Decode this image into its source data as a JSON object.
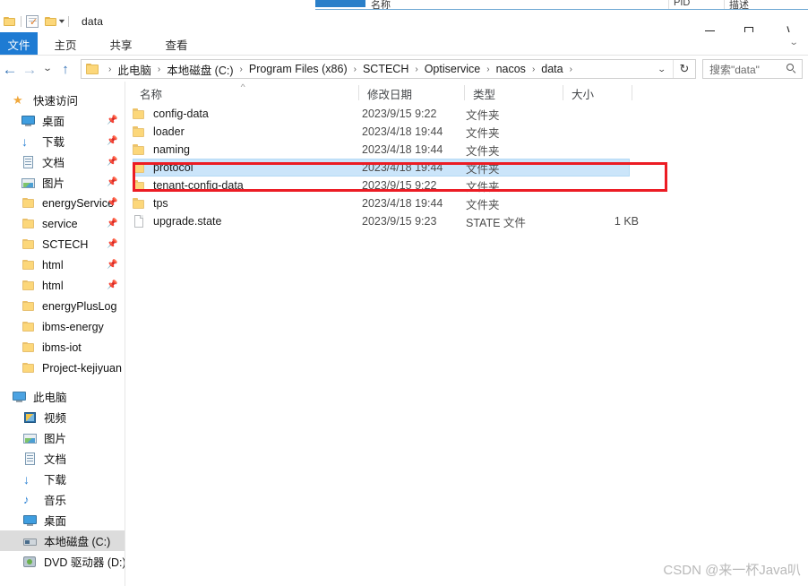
{
  "background_window": {
    "columns": [
      "名称",
      "PID",
      "描述"
    ]
  },
  "titlebar": {
    "title": "data",
    "quick_access": [
      {
        "name": "folder-icon",
        "label": "文件夹"
      },
      {
        "name": "properties-icon",
        "label": "属性"
      },
      {
        "name": "new-folder-icon",
        "label": "新建文件夹"
      }
    ],
    "customize_caret": "▾",
    "controls": {
      "minimize": "—",
      "maximize": "▢",
      "close": "✕"
    }
  },
  "ribbon": {
    "tabs": [
      {
        "label": "文件",
        "active": true
      },
      {
        "label": "主页",
        "active": false
      },
      {
        "label": "共享",
        "active": false
      },
      {
        "label": "查看",
        "active": false
      }
    ],
    "expand_caret": "⌄"
  },
  "addressbar": {
    "back": "←",
    "forward": "→",
    "recent": "⌄",
    "up": "↑",
    "breadcrumbs": [
      "此电脑",
      "本地磁盘 (C:)",
      "Program Files (x86)",
      "SCTECH",
      "Optiservice",
      "nacos",
      "data"
    ],
    "separator": "›",
    "dropdown_caret": "⌄",
    "refresh": "↻",
    "search_placeholder": "搜索\"data\"",
    "search_value": ""
  },
  "navpane": {
    "groups": [
      {
        "header": {
          "label": "快速访问",
          "icon": "star-icon"
        },
        "items": [
          {
            "label": "桌面",
            "icon": "desktop-icon",
            "pinned": true
          },
          {
            "label": "下载",
            "icon": "download-icon",
            "pinned": true
          },
          {
            "label": "文档",
            "icon": "document-icon",
            "pinned": true
          },
          {
            "label": "图片",
            "icon": "picture-icon",
            "pinned": true
          },
          {
            "label": "energyService",
            "icon": "folder-icon",
            "pinned": true
          },
          {
            "label": "service",
            "icon": "folder-icon",
            "pinned": true
          },
          {
            "label": "SCTECH",
            "icon": "folder-icon",
            "pinned": true
          },
          {
            "label": "html",
            "icon": "folder-icon",
            "pinned": true
          },
          {
            "label": "html",
            "icon": "folder-icon",
            "pinned": true
          },
          {
            "label": "energyPlusLog",
            "icon": "folder-icon",
            "pinned": false
          },
          {
            "label": "ibms-energy",
            "icon": "folder-icon",
            "pinned": false
          },
          {
            "label": "ibms-iot",
            "icon": "folder-icon",
            "pinned": false
          },
          {
            "label": "Project-kejiyuan",
            "icon": "folder-icon",
            "pinned": false
          }
        ]
      },
      {
        "header": {
          "label": "此电脑",
          "icon": "computer-icon"
        },
        "items": [
          {
            "label": "视频",
            "icon": "video-icon",
            "pinned": false
          },
          {
            "label": "图片",
            "icon": "picture-icon",
            "pinned": false
          },
          {
            "label": "文档",
            "icon": "document-icon",
            "pinned": false
          },
          {
            "label": "下载",
            "icon": "download-icon",
            "pinned": false
          },
          {
            "label": "音乐",
            "icon": "music-icon",
            "pinned": false
          },
          {
            "label": "桌面",
            "icon": "desktop-icon",
            "pinned": false
          },
          {
            "label": "本地磁盘 (C:)",
            "icon": "drive-icon",
            "pinned": false,
            "selected": true
          },
          {
            "label": "DVD 驱动器 (D:) S!",
            "icon": "dvd-icon",
            "pinned": false
          }
        ]
      }
    ]
  },
  "filelist": {
    "columns": [
      {
        "label": "名称",
        "sorted": true,
        "sort_dir": "asc"
      },
      {
        "label": "修改日期"
      },
      {
        "label": "类型"
      },
      {
        "label": "大小"
      }
    ],
    "rows": [
      {
        "name": "config-data",
        "date": "2023/9/15 9:22",
        "type": "文件夹",
        "size": "",
        "icon": "folder-icon",
        "selected": false
      },
      {
        "name": "loader",
        "date": "2023/4/18 19:44",
        "type": "文件夹",
        "size": "",
        "icon": "folder-icon",
        "selected": false
      },
      {
        "name": "naming",
        "date": "2023/4/18 19:44",
        "type": "文件夹",
        "size": "",
        "icon": "folder-icon",
        "selected": false
      },
      {
        "name": "protocol",
        "date": "2023/4/18 19:44",
        "type": "文件夹",
        "size": "",
        "icon": "folder-icon",
        "selected": true
      },
      {
        "name": "tenant-config-data",
        "date": "2023/9/15 9:22",
        "type": "文件夹",
        "size": "",
        "icon": "folder-icon",
        "selected": false
      },
      {
        "name": "tps",
        "date": "2023/4/18 19:44",
        "type": "文件夹",
        "size": "",
        "icon": "folder-icon",
        "selected": false
      },
      {
        "name": "upgrade.state",
        "date": "2023/9/15 9:23",
        "type": "STATE 文件",
        "size": "1 KB",
        "icon": "file-icon",
        "selected": false
      }
    ]
  },
  "annotation": {
    "color": "#ec1c24",
    "target_row": "protocol"
  },
  "watermark": {
    "text": "CSDN @来一杯Java叭"
  }
}
